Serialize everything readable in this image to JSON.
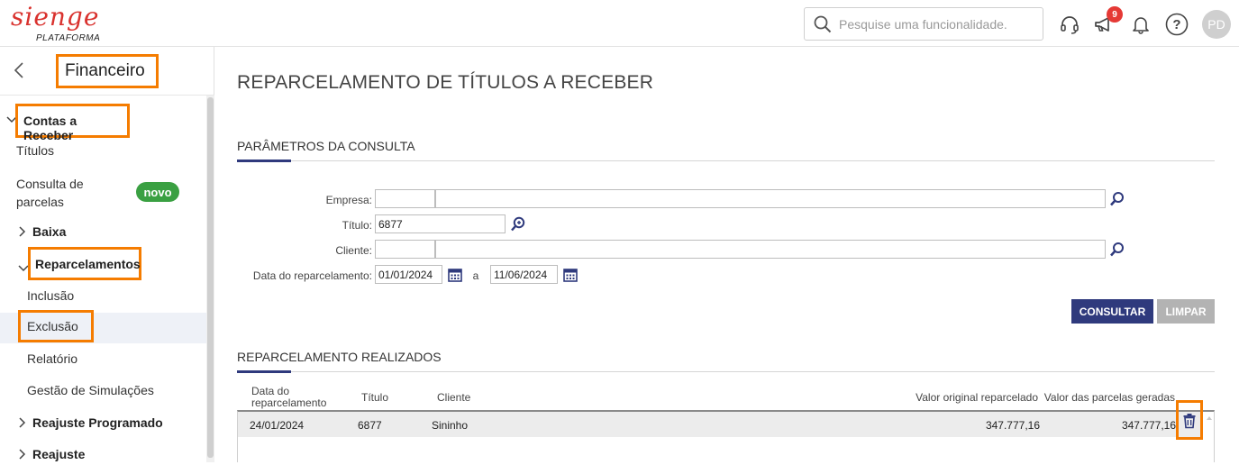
{
  "brand": {
    "name": "SIENGE",
    "subtitle": "PLATAFORMA"
  },
  "topbar": {
    "search_placeholder": "Pesquise uma funcionalidade.",
    "notification_count": "9",
    "avatar_initials": "PD"
  },
  "sidebar": {
    "title": "Financeiro",
    "section": "Contas a Receber",
    "items": {
      "titulos": "Títulos",
      "consulta_line1": "Consulta de",
      "consulta_line2": "parcelas",
      "novo_badge": "novo",
      "baixa": "Baixa",
      "reparcelamentos": "Reparcelamentos",
      "inclusao": "Inclusão",
      "exclusao": "Exclusão",
      "relatorio": "Relatório",
      "gestao": "Gestão de Simulações",
      "reajuste_programado": "Reajuste Programado",
      "reajuste": "Reajuste"
    }
  },
  "main": {
    "page_title": "REPARCELAMENTO DE TÍTULOS A RECEBER",
    "params_title": "PARÂMETROS DA CONSULTA",
    "form": {
      "empresa_label": "Empresa:",
      "empresa_code": "",
      "empresa_name": "",
      "titulo_label": "Título:",
      "titulo_value": "6877",
      "cliente_label": "Cliente:",
      "cliente_code": "",
      "cliente_name": "",
      "data_label": "Data do reparcelamento:",
      "date_from": "01/01/2024",
      "date_sep": "a",
      "date_to": "11/06/2024"
    },
    "buttons": {
      "consultar": "CONSULTAR",
      "limpar": "LIMPAR"
    },
    "results_title": "REPARCELAMENTO REALIZADOS",
    "table": {
      "headers": {
        "data_line1": "Data do",
        "data_line2": "reparcelamento",
        "titulo": "Título",
        "cliente": "Cliente",
        "valor_original": "Valor original reparcelado",
        "valor_parcelas": "Valor das parcelas geradas"
      },
      "rows": [
        {
          "data": "24/01/2024",
          "titulo": "6877",
          "cliente": "Sininho",
          "valor_original": "347.777,16",
          "valor_parcelas": "347.777,16"
        }
      ]
    }
  },
  "colors": {
    "accent": "#2f3a7d",
    "highlight": "#f57c00",
    "brand": "#d9322e",
    "badge_green": "#3aa042"
  }
}
